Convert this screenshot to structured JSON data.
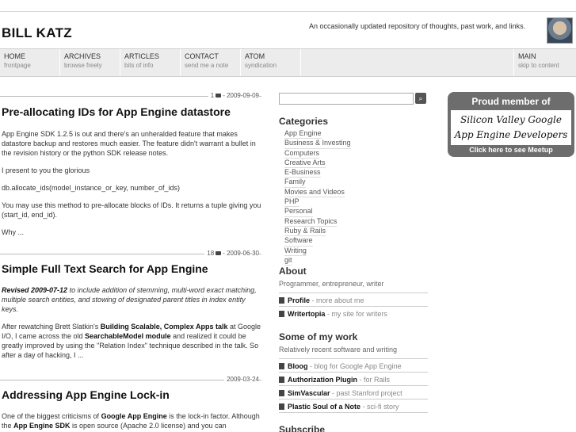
{
  "site": {
    "title": "BILL KATZ",
    "tagline": "An occasionally updated repository of thoughts, past work, and links."
  },
  "nav": [
    {
      "label": "HOME",
      "sub": "frontpage"
    },
    {
      "label": "ARCHIVES",
      "sub": "browse freely"
    },
    {
      "label": "ARTICLES",
      "sub": "bits of info"
    },
    {
      "label": "CONTACT",
      "sub": "send me a note"
    },
    {
      "label": "ATOM",
      "sub": "syndication"
    },
    {
      "label": "MAIN",
      "sub": "skip to content"
    }
  ],
  "posts": [
    {
      "comments": "1",
      "date": "2009-09-09",
      "title": "Pre-allocating IDs for App Engine datastore",
      "p1": "App Engine SDK 1.2.5 is out and there's an unheralded feature that makes datastore backup and restores much easier.  The feature didn't warrant a bullet in the revision history or the python SDK release notes.",
      "p2": "I present to you the glorious",
      "p3": "db.allocate_ids(model_instance_or_key, number_of_ids)",
      "p4": "You may use this method to pre-allocate blocks of IDs.  It returns a tuple giving you (start_id, end_id).",
      "p5": "Why ..."
    },
    {
      "comments": "18",
      "date": "2009-06-30",
      "title": "Simple Full Text Search for App Engine",
      "revised": "Revised 2009-07-12",
      "revised_rest": " to include addition of stemming, multi-word exact matching, multiple search entities, and stowing of designated parent titles in index entity keys.",
      "a1": "After rewatching Brett Slatkin's ",
      "a1_link": "Building Scalable, Complex Apps talk",
      "a2": " at Google I/O, I came across the old ",
      "a2_link": "SearchableModel module",
      "a3": " and realized it could be greatly improved by using the \"Relation Index\" technique described in the talk.  So after a day of hacking, I ..."
    },
    {
      "date": "2009-03-24",
      "title": "Addressing App Engine Lock-in",
      "b1": "One of the biggest criticisms of ",
      "b1_link": "Google App Engine",
      "b2": " is the lock-in factor. Although the ",
      "b2_link": "App Engine SDK",
      "b3": " is open source (Apache 2.0 license) and you can"
    }
  ],
  "sidebar": {
    "search_button": "⌕",
    "categories_title": "Categories",
    "categories": [
      "App Engine",
      "Business & Investing",
      "Computers",
      "Creative Arts",
      "E-Business",
      "Family",
      "Movies and Videos",
      "PHP",
      "Personal",
      "Research Topics",
      "Ruby & Rails",
      "Software",
      "Writing",
      "git"
    ],
    "about_title": "About",
    "about_sub": "Programmer, entrepreneur, writer",
    "about_links": [
      {
        "label": "Profile",
        "desc": " - more about me"
      },
      {
        "label": "Writertopia",
        "desc": " - my site for writers"
      }
    ],
    "work_title": "Some of my work",
    "work_sub": "Relatively recent software and writing",
    "work_links": [
      {
        "label": "Bloog",
        "desc": " - blog for Google App Engine"
      },
      {
        "label": "Authorization Plugin",
        "desc": " - for Rails"
      },
      {
        "label": "SimVascular",
        "desc": " - past Stanford project"
      },
      {
        "label": "Plastic Soul of a Note",
        "desc": " - sci-fi story"
      }
    ],
    "subscribe_title": "Subscribe"
  },
  "meetup": {
    "top": "Proud member of",
    "line1": "Silicon Valley Google",
    "line2": "App Engine Developers",
    "bottom": "Click here to see Meetup"
  }
}
